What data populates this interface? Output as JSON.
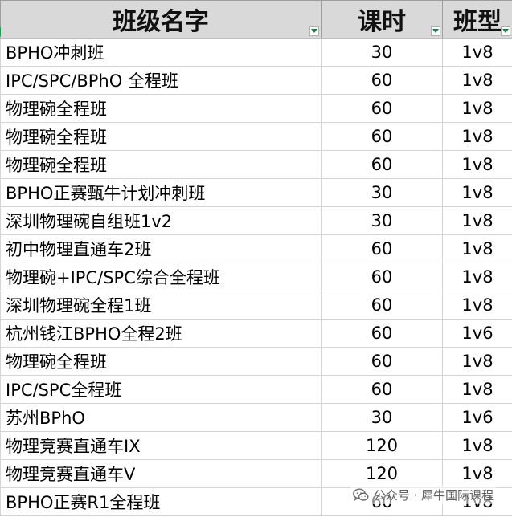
{
  "header": {
    "name_label": "班级名字",
    "hours_label": "课时",
    "type_label": "班型"
  },
  "rows": [
    {
      "name": "BPHO冲刺班",
      "hours": "30",
      "type": "1v8"
    },
    {
      "name": "IPC/SPC/BPhO 全程班",
      "hours": "60",
      "type": "1v8"
    },
    {
      "name": "物理碗全程班",
      "hours": "60",
      "type": "1v8"
    },
    {
      "name": "物理碗全程班",
      "hours": "60",
      "type": "1v8"
    },
    {
      "name": "物理碗全程班",
      "hours": "60",
      "type": "1v8"
    },
    {
      "name": "BPHO正赛甄牛计划冲刺班",
      "hours": "30",
      "type": "1v8"
    },
    {
      "name": "深圳物理碗自组班1v2",
      "hours": "30",
      "type": "1v8"
    },
    {
      "name": "初中物理直通车2班",
      "hours": "60",
      "type": "1v8"
    },
    {
      "name": "物理碗+IPC/SPC综合全程班",
      "hours": "60",
      "type": "1v8"
    },
    {
      "name": "深圳物理碗全程1班",
      "hours": "60",
      "type": "1v8"
    },
    {
      "name": "杭州钱江BPHO全程2班",
      "hours": "60",
      "type": "1v6"
    },
    {
      "name": "物理碗全程班",
      "hours": "60",
      "type": "1v8"
    },
    {
      "name": "IPC/SPC全程班",
      "hours": "60",
      "type": "1v8"
    },
    {
      "name": "苏州BPhO",
      "hours": "30",
      "type": "1v6"
    },
    {
      "name": "物理竞赛直通车IX",
      "hours": "120",
      "type": "1v8"
    },
    {
      "name": "物理竞赛直通车V",
      "hours": "120",
      "type": "1v8"
    },
    {
      "name": "BPHO正赛R1全程班",
      "hours": "60",
      "type": "1v8"
    }
  ],
  "watermark": {
    "text": "公众号 · 犀牛国际课程",
    "icon": "wechat-icon"
  },
  "colors": {
    "header_bg": "#d9d9d9",
    "filter_arrow": "#1e7b45",
    "gridline": "#d4d4d4"
  }
}
